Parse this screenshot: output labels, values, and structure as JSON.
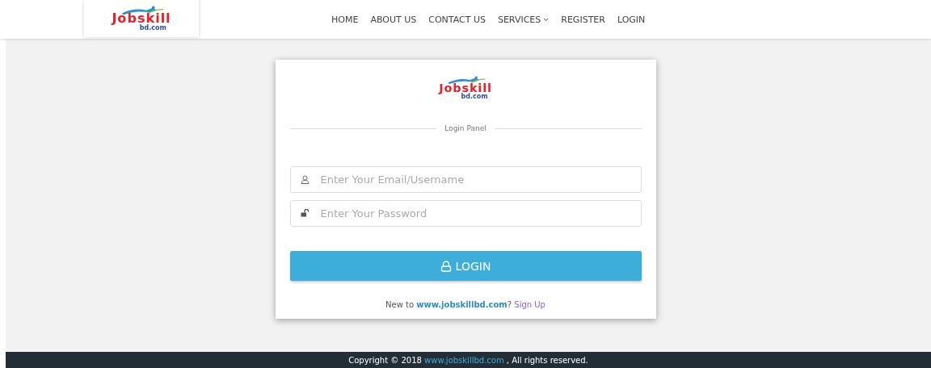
{
  "header": {
    "logo": {
      "word": "Jobskill",
      "domain": "bd.com"
    },
    "nav": [
      {
        "label": "HOME",
        "dropdown": false
      },
      {
        "label": "ABOUT US",
        "dropdown": false
      },
      {
        "label": "CONTACT US",
        "dropdown": false
      },
      {
        "label": "SERVICES",
        "dropdown": true
      },
      {
        "label": "REGISTER",
        "dropdown": false
      },
      {
        "label": "LOGIN",
        "dropdown": false
      }
    ]
  },
  "login_panel": {
    "logo": {
      "word": "Jobskill",
      "domain": "bd.com"
    },
    "heading": "Login Panel",
    "fields": [
      {
        "kind": "user",
        "placeholder": "Enter Your Email/Username"
      },
      {
        "kind": "password",
        "placeholder": "Enter Your Password"
      }
    ],
    "button": "LOGIN",
    "signup": {
      "prefix": "New to ",
      "site": "www.jobskillbd.com",
      "suffix": "? ",
      "link": "Sign Up"
    }
  },
  "footer": {
    "prefix": "Copyright © 2018 ",
    "site": "www.jobskillbd.com",
    "suffix": " , All rights reserved."
  }
}
